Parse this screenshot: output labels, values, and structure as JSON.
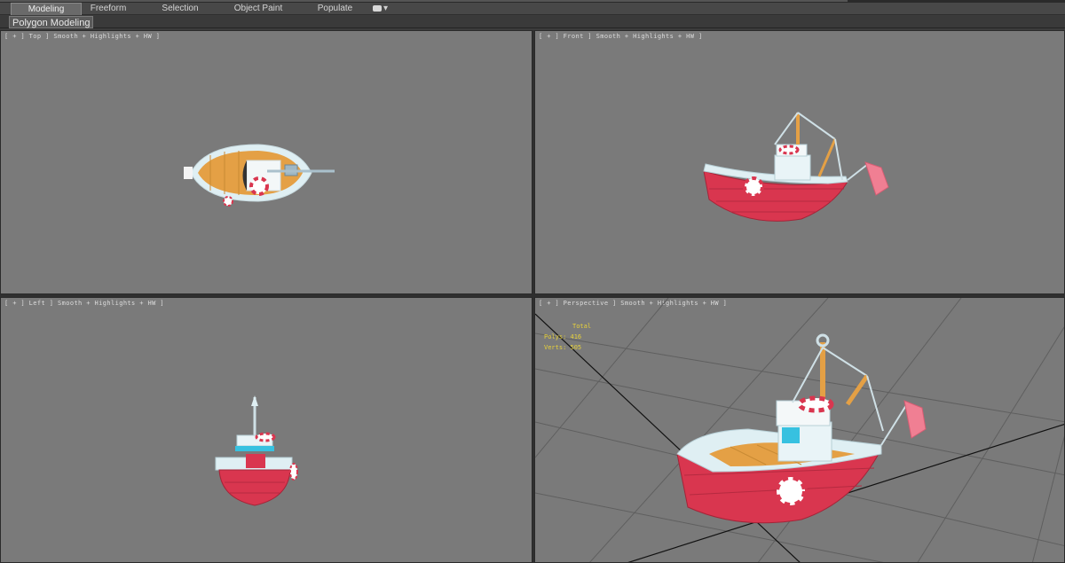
{
  "ribbon": {
    "tabs": [
      {
        "label": "Modeling",
        "active": true
      },
      {
        "label": "Freeform",
        "active": false
      },
      {
        "label": "Selection",
        "active": false
      },
      {
        "label": "Object Paint",
        "active": false
      },
      {
        "label": "Populate",
        "active": false
      }
    ],
    "extra_icon": "camera-dropdown-icon",
    "extra_arrow": "▾",
    "subtab_label": "Polygon Modeling"
  },
  "viewports": {
    "top": {
      "label": "[ + ] Top ] Smooth + Highlights + HW ]"
    },
    "front": {
      "label": "[ + ] Front ] Smooth + Highlights + HW ]"
    },
    "left": {
      "label": "[ + ] Left ] Smooth + Highlights + HW ]"
    },
    "perspective": {
      "label": "[ + ] Perspective ] Smooth + Highlights + HW ]",
      "stats": {
        "title": "Total",
        "polys": "Polys: 416",
        "verts": "Verts: 505"
      }
    }
  },
  "colors": {
    "viewport_bg": "#7a7a7a",
    "hull_red": "#d9364f",
    "deck_wood": "#e4a045",
    "trim_white": "#dfeff3",
    "flag_pink": "#f07f93",
    "stats_yellow": "#e8d23a"
  }
}
